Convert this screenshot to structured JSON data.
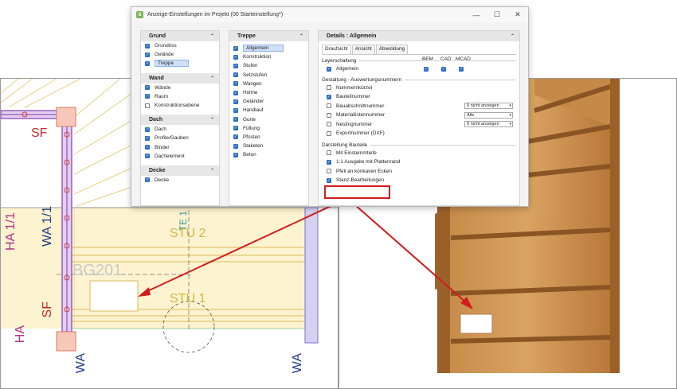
{
  "dialog": {
    "app_icon": "S",
    "title": "Anzeige-Einstellungen im Projekt  (00 Starteinstellung*)",
    "controls": {
      "minimize": "—",
      "maximize": "☐",
      "close": "✕"
    }
  },
  "left_column": {
    "sections": [
      {
        "title": "Grund",
        "items": [
          {
            "label": "Grundriss",
            "checked": true
          },
          {
            "label": "Gelände",
            "checked": true
          },
          {
            "label": "Treppe",
            "checked": true,
            "selected": true
          }
        ]
      },
      {
        "title": "Wand",
        "items": [
          {
            "label": "Wände",
            "checked": true
          },
          {
            "label": "Raum",
            "checked": true
          },
          {
            "label": "Konstruktionsebene",
            "checked": false
          }
        ]
      },
      {
        "title": "Dach",
        "items": [
          {
            "label": "Dach",
            "checked": true
          },
          {
            "label": "Profile/Gauben",
            "checked": true
          },
          {
            "label": "Binder",
            "checked": true
          },
          {
            "label": "Dachelement",
            "checked": true
          }
        ]
      },
      {
        "title": "Decke",
        "items": [
          {
            "label": "Decke",
            "checked": true
          }
        ]
      }
    ]
  },
  "middle_column": {
    "title": "Treppe",
    "items": [
      {
        "label": "Allgemein",
        "checked": true,
        "selected": true
      },
      {
        "label": "Konstruktion",
        "checked": true
      },
      {
        "label": "Stufen",
        "checked": true
      },
      {
        "label": "Setzstufen",
        "checked": true
      },
      {
        "label": "Wangen",
        "checked": true
      },
      {
        "label": "Holme",
        "checked": true
      },
      {
        "label": "Geländer",
        "checked": true
      },
      {
        "label": "Handlauf",
        "checked": true
      },
      {
        "label": "Gurte",
        "checked": true
      },
      {
        "label": "Füllung",
        "checked": true
      },
      {
        "label": "Pfosten",
        "checked": true
      },
      {
        "label": "Staketen",
        "checked": true
      },
      {
        "label": "Beton",
        "checked": true
      }
    ]
  },
  "details": {
    "title": "Details : Allgemein",
    "tabs": [
      "Draufsicht",
      "Ansicht",
      "Abwicklung"
    ],
    "layerschaltung": {
      "title": "Layerschaltung",
      "col_bem": "BEM",
      "col_cad": "CAD",
      "col_mcad": "MCAD",
      "row_label": "Allgemein"
    },
    "gestaltung": {
      "title": "Gestaltung - Auswertungsnummern",
      "rows": [
        {
          "label": "Nummernkürzel",
          "checked": false
        },
        {
          "label": "Bauteilnummer",
          "checked": true
        },
        {
          "label": "Bauabschnittnummer",
          "checked": false,
          "combo": "0 nicht anzeigen"
        },
        {
          "label": "Materiallistennummer",
          "checked": false,
          "combo": "Alle"
        },
        {
          "label": "Nestingnummer",
          "checked": false,
          "combo": "0 nicht anzeigen"
        },
        {
          "label": "Exportnummer (DXF)",
          "checked": false
        }
      ]
    },
    "darstellung": {
      "title": "Darstellung Bauteile",
      "rows": [
        {
          "label": "Mit Einstemmtiefe",
          "checked": false
        },
        {
          "label": "1:1 Ausgabe mit Plattenrand",
          "checked": true
        },
        {
          "label": "Pfeil an konkaven Ecken",
          "checked": false
        },
        {
          "label": "Stanz-Bearbeitungen",
          "checked": true
        }
      ]
    }
  },
  "drawing": {
    "labels": {
      "sf_top": "SF",
      "sf_bottom": "SF",
      "ha_11": "HA 1/1",
      "wa_11": "WA 1/1",
      "ha": "HA",
      "wa_left": "WA",
      "wa_right": "WA",
      "stu2": "STU 2",
      "stu1": "STU 1",
      "bg201": "BG201",
      "te1": "TE 1"
    }
  },
  "colors": {
    "accent": "#2e6fc7",
    "highlight": "#d21d1d",
    "wall_purple": "#7a3fb0",
    "stair_fill": "#fdf3d0",
    "wood": "#b57a3a"
  }
}
